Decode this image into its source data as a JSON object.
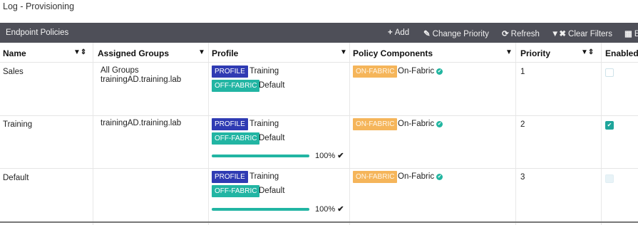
{
  "breadcrumb": "Log - Provisioning",
  "toolbar": {
    "title": "Endpoint Policies",
    "add": "Add",
    "change_priority": "Change Priority",
    "refresh": "Refresh",
    "clear_filters": "Clear Filters",
    "edit_partial": "E"
  },
  "columns": {
    "name": "Name",
    "assigned_groups": "Assigned Groups",
    "profile": "Profile",
    "policy_components": "Policy Components",
    "priority": "Priority",
    "enabled": "Enabled"
  },
  "tags": {
    "profile": "PROFILE",
    "off_fabric": "OFF-FABRIC",
    "on_fabric": "ON-FABRIC"
  },
  "rows": [
    {
      "name": "Sales",
      "groups": [
        "All Groups",
        "trainingAD.training.lab"
      ],
      "profile_name": "Training",
      "off_fabric_name": "Default",
      "on_fabric_name": "On-Fabric",
      "priority": "1",
      "enabled": false,
      "progress": null
    },
    {
      "name": "Training",
      "groups": [
        "trainingAD.training.lab"
      ],
      "profile_name": "Training",
      "off_fabric_name": "Default",
      "on_fabric_name": "On-Fabric",
      "priority": "2",
      "enabled": true,
      "progress": "100%"
    },
    {
      "name": "Default",
      "groups": [],
      "profile_name": "Training",
      "off_fabric_name": "Default",
      "on_fabric_name": "On-Fabric",
      "priority": "3",
      "enabled": false,
      "progress": "100%"
    }
  ]
}
